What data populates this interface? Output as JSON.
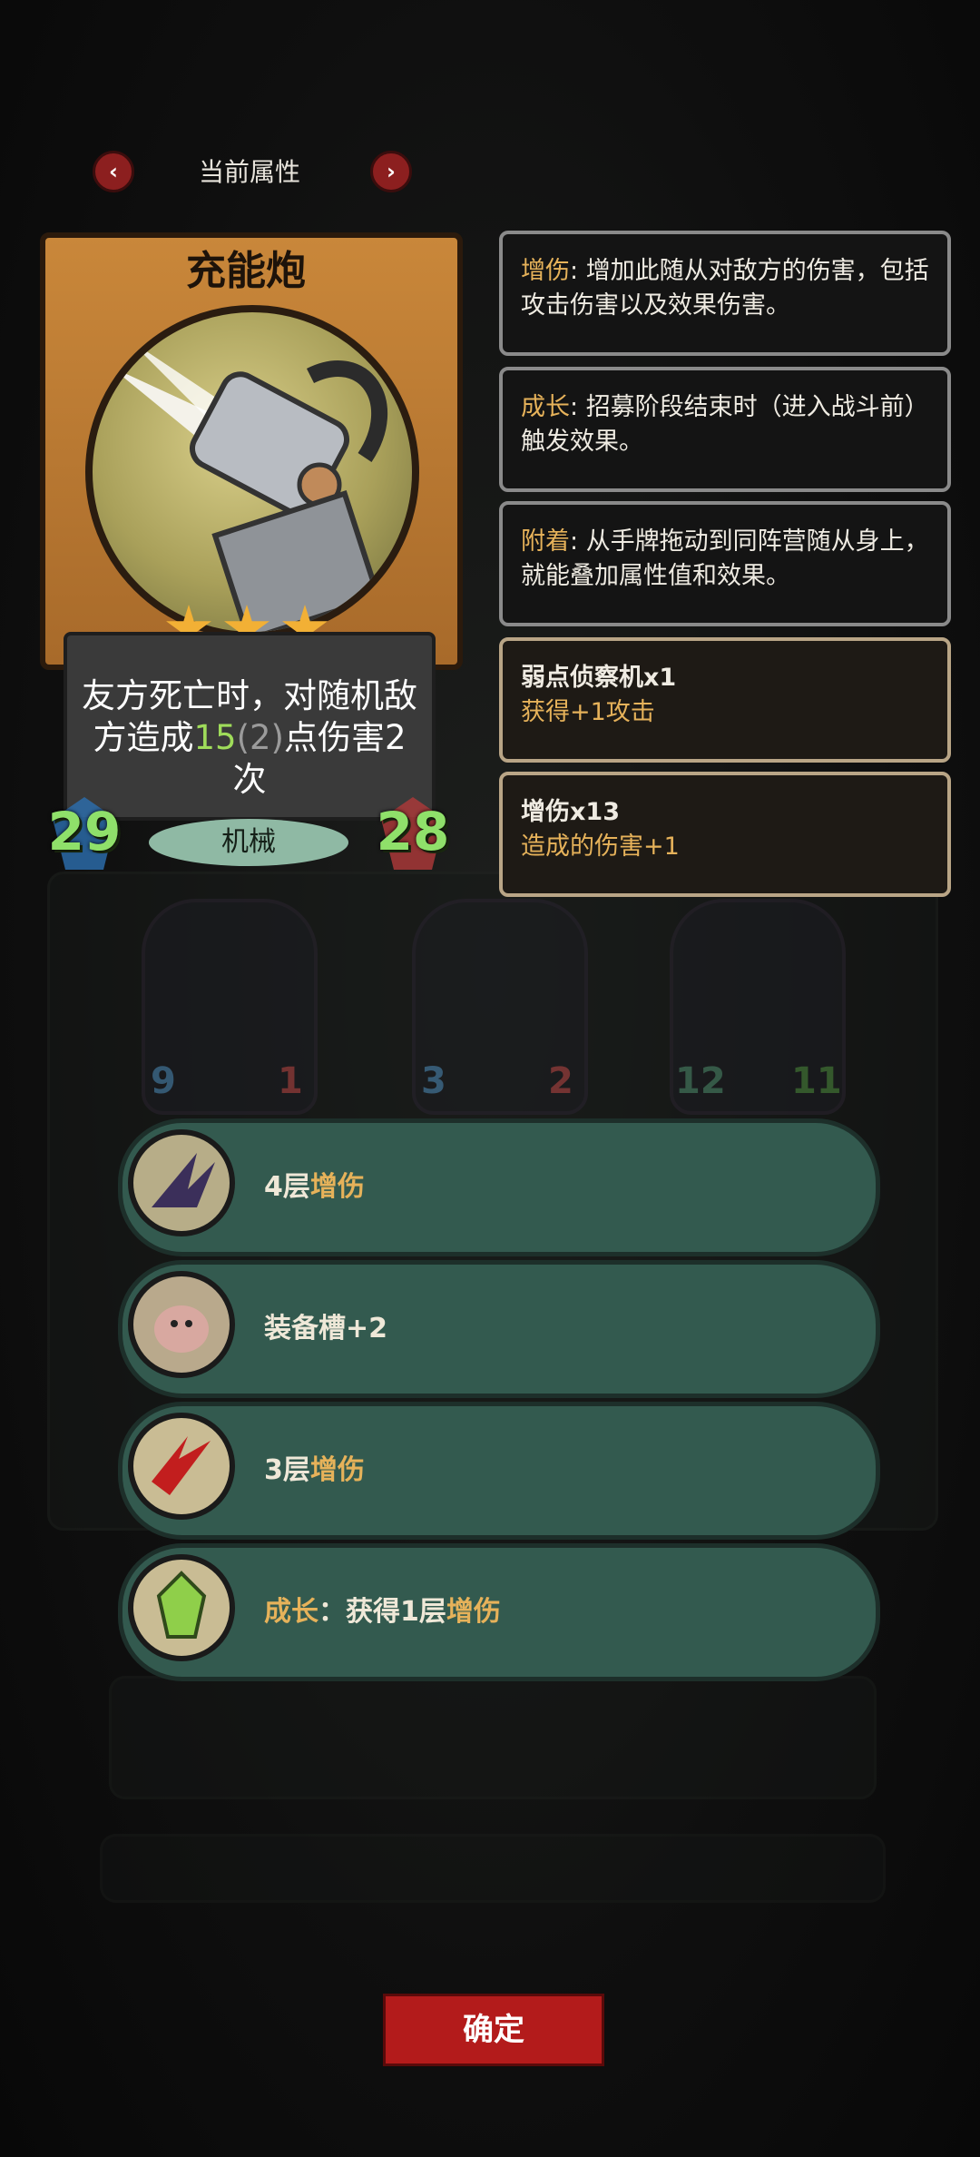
{
  "header": {
    "title": "当前属性",
    "prev_icon": "chevron-left-icon",
    "next_icon": "chevron-right-icon"
  },
  "card": {
    "name": "充能炮",
    "stars": 3,
    "text_line1": "友方死亡时，对随机敌",
    "text_line2_pre": "方造成",
    "text_damage": "15",
    "text_bonus": "(2)",
    "text_line2_post": "点伤害2次",
    "attack": "29",
    "health": "28",
    "tribe": "机械"
  },
  "keywords": [
    {
      "term": "增伤",
      "sep": ": ",
      "desc": "增加此随从对敌方的伤害，包括攻击伤害以及效果伤害。"
    },
    {
      "term": "成长",
      "sep": ": ",
      "desc": "招募阶段结束时（进入战斗前）触发效果。"
    },
    {
      "term": "附着",
      "sep": ": ",
      "desc": "从手牌拖动到同阵营随从身上，就能叠加属性值和效果。"
    }
  ],
  "applied": [
    {
      "title": "弱点侦察机x1",
      "effect": "获得+1攻击"
    },
    {
      "title": "增伤x13",
      "effect": "造成的伤害+1"
    }
  ],
  "buffs": [
    {
      "pre": "4层",
      "key": "增伤",
      "post": "",
      "icon": "claw-icon"
    },
    {
      "pre": "装备槽+2",
      "key": "",
      "post": "",
      "icon": "pig-icon"
    },
    {
      "pre": "3层",
      "key": "增伤",
      "post": "",
      "icon": "blood-slash-icon"
    },
    {
      "pre": "",
      "key": "成长",
      "post": "：获得1层",
      "key2": "增伤",
      "icon": "crystal-icon"
    }
  ],
  "board_units": [
    {
      "atk": "9",
      "hp": "1"
    },
    {
      "atk": "3",
      "hp": "2"
    },
    {
      "atk": "12",
      "hp": "11"
    }
  ],
  "confirm_label": "确定",
  "colors": {
    "keyword": "#e6b25a",
    "buff_row": "#335a4f",
    "confirm": "#b31b1b",
    "stat": "#8fe06a"
  }
}
